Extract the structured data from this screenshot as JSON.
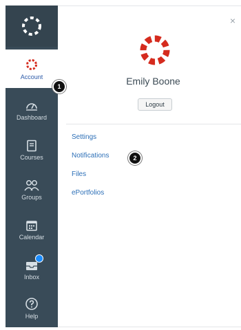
{
  "tray": {
    "user_name": "Emily Boone",
    "logout_label": "Logout",
    "close_label": "×",
    "links": [
      {
        "label": "Settings"
      },
      {
        "label": "Notifications"
      },
      {
        "label": "Files"
      },
      {
        "label": "ePortfolios"
      }
    ]
  },
  "nav": {
    "items": [
      {
        "label": "Account",
        "icon": "account-avatar-icon"
      },
      {
        "label": "Dashboard",
        "icon": "dashboard-icon"
      },
      {
        "label": "Courses",
        "icon": "courses-icon"
      },
      {
        "label": "Groups",
        "icon": "groups-icon"
      },
      {
        "label": "Calendar",
        "icon": "calendar-icon"
      },
      {
        "label": "Inbox",
        "icon": "inbox-icon"
      },
      {
        "label": "Help",
        "icon": "help-icon"
      }
    ]
  },
  "callouts": {
    "step1": "1",
    "step2": "2"
  },
  "colors": {
    "nav_bg": "#394b58",
    "brand_red": "#d52b1e",
    "link_blue": "#2c6fb7",
    "badge_blue": "#1a8cff"
  }
}
